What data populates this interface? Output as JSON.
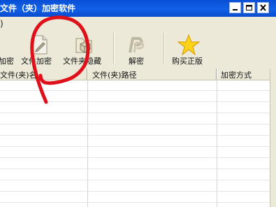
{
  "window": {
    "title": "文件（夹）加密软件",
    "controls": [
      "minimize",
      "maximize",
      "close"
    ]
  },
  "menubar": {
    "fragment": ")"
  },
  "toolbar": {
    "items": [
      {
        "label": "加密",
        "icon": "encrypt-icon"
      },
      {
        "label": "文件加密",
        "icon": "file-encrypt-icon"
      },
      {
        "label": "文件夹隐藏",
        "icon": "folder-hide-icon"
      },
      {
        "label": "解密",
        "icon": "decrypt-icon"
      },
      {
        "label": "购买正版",
        "icon": "star-icon"
      }
    ]
  },
  "table": {
    "columns": [
      "文件(夹)名",
      "文件(夹)路径",
      "加密方式"
    ],
    "rows": []
  },
  "annotation": {
    "color": "#e0101a",
    "shape": "hand-drawn-circle"
  }
}
